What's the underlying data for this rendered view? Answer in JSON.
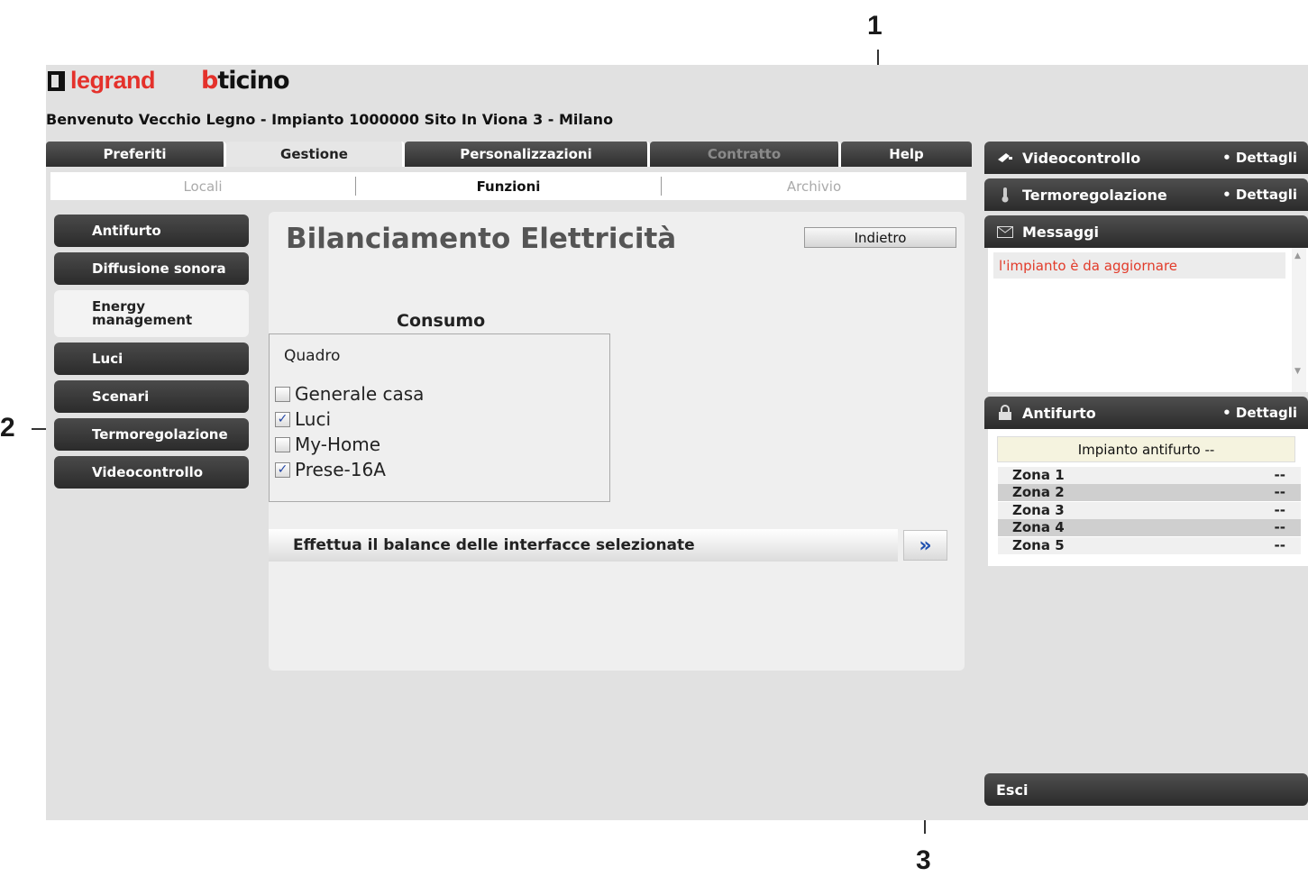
{
  "callouts": [
    "1",
    "2",
    "3"
  ],
  "brand": {
    "legrand": "legrand",
    "bticino_b": "b",
    "bticino_rest": "ticino"
  },
  "welcome": "Benvenuto Vecchio Legno - Impianto 1000000 Sito In Viona 3 - Milano",
  "top_tabs": [
    {
      "label": "Preferiti",
      "state": "normal"
    },
    {
      "label": "Gestione",
      "state": "active"
    },
    {
      "label": "Personalizzazioni",
      "state": "normal"
    },
    {
      "label": "Contratto",
      "state": "disabled"
    },
    {
      "label": "Help",
      "state": "normal"
    }
  ],
  "sub_tabs": [
    {
      "label": "Locali",
      "state": "disabled"
    },
    {
      "label": "Funzioni",
      "state": "active"
    },
    {
      "label": "Archivio",
      "state": "disabled"
    }
  ],
  "left_menu": [
    {
      "label": "Antifurto"
    },
    {
      "label": "Diffusione sonora"
    },
    {
      "label": "Energy management",
      "line1": "Energy",
      "line2": "management",
      "active": true
    },
    {
      "label": "Luci"
    },
    {
      "label": "Scenari"
    },
    {
      "label": "Termoregolazione"
    },
    {
      "label": "Videocontrollo"
    }
  ],
  "content": {
    "title": "Bilanciamento Elettricità",
    "back_label": "Indietro",
    "consumo_label": "Consumo",
    "quadro_label": "Quadro",
    "checkboxes": [
      {
        "label": "Generale casa",
        "checked": false
      },
      {
        "label": "Luci",
        "checked": true
      },
      {
        "label": "My-Home",
        "checked": false
      },
      {
        "label": "Prese-16A",
        "checked": true
      }
    ],
    "balance_label": "Effettua il balance delle interfacce selezionate",
    "balance_button": "»"
  },
  "widgets": {
    "videocontrollo": {
      "title": "Videocontrollo",
      "details": "• Dettagli",
      "icon": "camera-icon"
    },
    "termoregolazione": {
      "title": "Termoregolazione",
      "details": "• Dettagli",
      "icon": "thermometer-icon"
    },
    "messaggi": {
      "title": "Messaggi",
      "icon": "envelope-icon",
      "items": [
        "l'impianto è da aggiornare"
      ]
    },
    "antifurto": {
      "title": "Antifurto",
      "details": "• Dettagli",
      "icon": "lock-icon",
      "status": "Impianto antifurto --",
      "zones": [
        {
          "name": "Zona 1",
          "value": "--"
        },
        {
          "name": "Zona 2",
          "value": "--"
        },
        {
          "name": "Zona 3",
          "value": "--"
        },
        {
          "name": "Zona 4",
          "value": "--"
        },
        {
          "name": "Zona 5",
          "value": "--"
        }
      ]
    }
  },
  "exit_label": "Esci",
  "colors": {
    "brand_red": "#e4312b",
    "message_red": "#e23b2a",
    "accent_blue": "#1e50b0"
  }
}
